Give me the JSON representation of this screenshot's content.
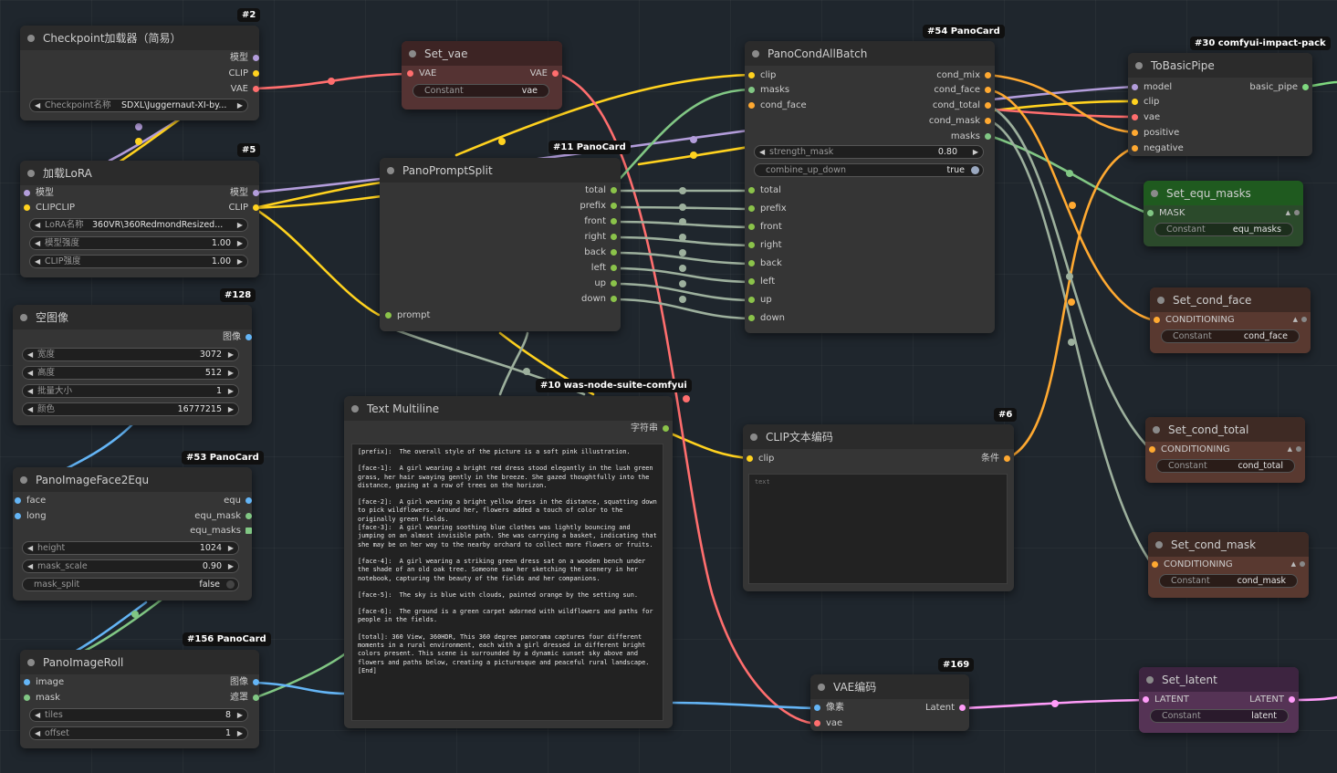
{
  "colors": {
    "model": "#b39ddb",
    "clip": "#ffd21f",
    "vae": "#ff6e6e",
    "conditioning": "#ffa931",
    "image": "#64b5f6",
    "mask": "#81c784",
    "latent": "#ff9cf9",
    "string": "#8bc34a",
    "basic_pipe": "#7fd97f",
    "int": "#a0e0a0"
  },
  "node2": {
    "badge": "#2",
    "title": "Checkpoint加载器（简易）",
    "outs": [
      "模型",
      "CLIP",
      "VAE"
    ],
    "w_label": "Checkpoint名称",
    "w_value": "SDXL\\Juggernaut-XI-by..."
  },
  "node5": {
    "badge": "#5",
    "title": "加载LoRA",
    "in_model": "模型",
    "in_clip": "CLIPCLIP",
    "out_model": "模型",
    "out_clip": "CLIP",
    "w1_label": "LoRA名称",
    "w1_value": "360VR\\360RedmondResized...",
    "w2_label": "模型强度",
    "w2_value": "1.00",
    "w3_label": "CLIP强度",
    "w3_value": "1.00"
  },
  "node128": {
    "badge": "#128",
    "title": "空图像",
    "out": "图像",
    "w1_label": "宽度",
    "w1_value": "3072",
    "w2_label": "高度",
    "w2_value": "512",
    "w3_label": "批量大小",
    "w3_value": "1",
    "w4_label": "颜色",
    "w4_value": "16777215"
  },
  "node53": {
    "badge": "#53 PanoCard",
    "title": "PanoImageFace2Equ",
    "in1": "face",
    "in2": "long",
    "out1": "equ",
    "out2": "equ_mask",
    "out3": "equ_masks",
    "w1_label": "height",
    "w1_value": "1024",
    "w2_label": "mask_scale",
    "w2_value": "0.90",
    "w3_label": "mask_split",
    "w3_value": "false"
  },
  "node156": {
    "badge": "#156 PanoCard",
    "title": "PanoImageRoll",
    "in1": "image",
    "in2": "mask",
    "out1": "图像",
    "out2": "遮罩",
    "w1_label": "tiles",
    "w1_value": "8",
    "w2_label": "offset",
    "w2_value": "1"
  },
  "setvae": {
    "title": "Set_vae",
    "in": "VAE",
    "out": "VAE",
    "w_label": "Constant",
    "w_value": "vae"
  },
  "node11": {
    "badge": "#11 PanoCard",
    "title": "PanoPromptSplit",
    "in": "prompt",
    "outs": [
      "total",
      "prefix",
      "front",
      "right",
      "back",
      "left",
      "up",
      "down"
    ]
  },
  "node10": {
    "badge": "#10 was-node-suite-comfyui",
    "title": "Text Multiline",
    "out": "字符串",
    "paragraphs": [
      "[prefix]:  The overall style of the picture is a soft pink illustration.",
      "[face-1]:  A girl wearing a bright red dress stood elegantly in the lush green grass, her hair swaying gently in the breeze. She gazed thoughtfully into the distance, gazing at a row of trees on the horizon.",
      "[face-2]:  A girl wearing a bright yellow dress in the distance, squatting down to pick wildflowers. Around her, flowers added a touch of color to the originally green fields.\n[face-3]:  A girl wearing soothing blue clothes was lightly bouncing and jumping on an almost invisible path. She was carrying a basket, indicating that she may be on her way to the nearby orchard to collect more flowers or fruits.",
      "[face-4]:  A girl wearing a striking green dress sat on a wooden bench under the shade of an old oak tree. Someone saw her sketching the scenery in her notebook, capturing the beauty of the fields and her companions.",
      "[face-5]:  The sky is blue with clouds, painted orange by the setting sun.",
      "[face-6]:  The ground is a green carpet adorned with wildflowers and paths for people in the fields.",
      "[total]: 360 View, 360HDR, This 360 degree panorama captures four different moments in a rural environment, each with a girl dressed in different bright colors present. This scene is surrounded by a dynamic sunset sky above and flowers and paths below, creating a picturesque and peaceful rural landscape.\n[End]"
    ]
  },
  "node54": {
    "badge": "#54 PanoCard",
    "title": "PanoCondAllBatch",
    "ins": [
      "clip",
      "masks",
      "cond_face"
    ],
    "outs": [
      "cond_mix",
      "cond_face",
      "cond_total",
      "cond_mask",
      "masks"
    ],
    "w1_label": "strength_mask",
    "w1_value": "0.80",
    "w2_label": "combine_up_down",
    "w2_value": "true",
    "ins2": [
      "total",
      "prefix",
      "front",
      "right",
      "back",
      "left",
      "up",
      "down"
    ]
  },
  "node6": {
    "badge": "#6",
    "title": "CLIP文本编码",
    "in": "clip",
    "out": "条件",
    "placeholder": "text"
  },
  "node169": {
    "badge": "#169",
    "title": "VAE编码",
    "in1": "像素",
    "in2": "vae",
    "out": "Latent"
  },
  "node30": {
    "badge": "#30 comfyui-impact-pack",
    "title": "ToBasicPipe",
    "ins": [
      "model",
      "clip",
      "vae",
      "positive",
      "negative"
    ],
    "out": "basic_pipe"
  },
  "setmasks": {
    "title": "Set_equ_masks",
    "in": "MASK",
    "w_label": "Constant",
    "w_value": "equ_masks"
  },
  "setface": {
    "title": "Set_cond_face",
    "in": "CONDITIONING",
    "w_label": "Constant",
    "w_value": "cond_face"
  },
  "settotal": {
    "title": "Set_cond_total",
    "in": "CONDITIONING",
    "w_label": "Constant",
    "w_value": "cond_total"
  },
  "setmask": {
    "title": "Set_cond_mask",
    "in": "CONDITIONING",
    "w_label": "Constant",
    "w_value": "cond_mask"
  },
  "setlatent": {
    "title": "Set_latent",
    "in": "LATENT",
    "out": "LATENT",
    "w_label": "Constant",
    "w_value": "latent"
  }
}
